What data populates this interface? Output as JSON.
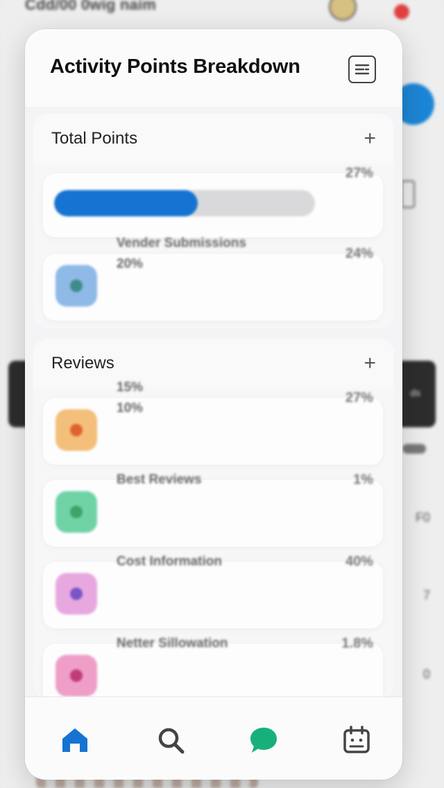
{
  "background": {
    "title": "Cdd/00 0wig naim",
    "dark_banner_text": "ds",
    "side_values": [
      "F0",
      "7",
      "0"
    ]
  },
  "modal": {
    "title": "Activity Points Breakdown",
    "header_icon": "filter-list-icon",
    "sections": [
      {
        "title": "Total Points",
        "add_icon": "plus-icon",
        "progress": {
          "fraction": 0.55,
          "label": "27%"
        },
        "items": [
          {
            "line1": "Vender Submissions",
            "line2": "20%",
            "percent": "24%",
            "icon_color": "#8fb9e6",
            "dot_color": "#3f8a8a"
          }
        ]
      },
      {
        "title": "Reviews",
        "add_icon": "plus-icon",
        "items": [
          {
            "line1": "15%",
            "line2": "10%",
            "percent": "27%",
            "icon_color": "#f3bf7a",
            "dot_color": "#e0622e"
          },
          {
            "line1": "Best Reviews",
            "line2": "",
            "percent": "1%",
            "icon_color": "#6fd3a6",
            "dot_color": "#3da36a"
          },
          {
            "line1": "Cost Information",
            "line2": "",
            "percent": "40%",
            "icon_color": "#e7a8e0",
            "dot_color": "#7a55c8"
          },
          {
            "line1": "Netter Sillowation",
            "line2": "",
            "percent": "1.8%",
            "icon_color": "#ef9ec8",
            "dot_color": "#c03b7a"
          }
        ]
      }
    ]
  },
  "tabbar": {
    "tabs": [
      {
        "icon": "home-icon",
        "active": true
      },
      {
        "icon": "search-icon",
        "active": false
      },
      {
        "icon": "chat-bubble-icon",
        "active": false
      },
      {
        "icon": "calendar-icon",
        "active": false
      }
    ]
  },
  "colors": {
    "accent": "#1673d1",
    "chat": "#18b07a"
  }
}
